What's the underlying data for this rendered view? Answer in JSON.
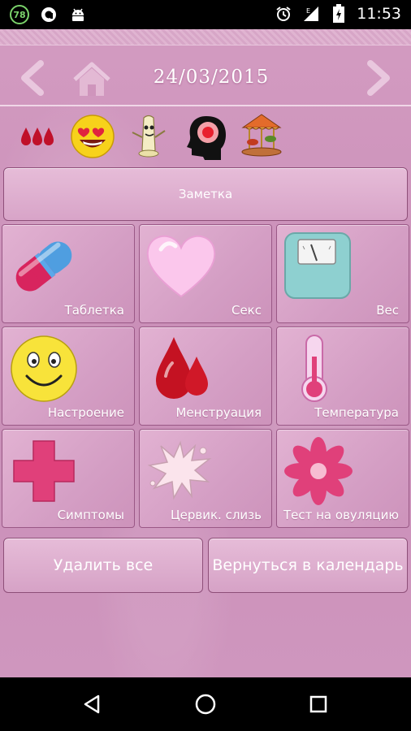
{
  "status_bar": {
    "notification_badge": "78",
    "time": "11:53",
    "icons": [
      "aptoide-icon",
      "android-icon",
      "alarm-icon",
      "signal-icon",
      "battery-icon"
    ]
  },
  "header": {
    "date": "24/03/2015",
    "icons": [
      "prev-arrow-icon",
      "home-icon",
      "next-arrow-icon"
    ]
  },
  "quick_icons": [
    "blood-drops-icon",
    "love-smiley-icon",
    "condom-icon",
    "head-brain-icon",
    "carousel-icon"
  ],
  "note_button": {
    "label": "Заметка"
  },
  "tiles": [
    {
      "label": "Таблетка",
      "icon": "pill-icon"
    },
    {
      "label": "Секс",
      "icon": "heart-icon"
    },
    {
      "label": "Вес",
      "icon": "scale-icon"
    },
    {
      "label": "Настроение",
      "icon": "smiley-icon"
    },
    {
      "label": "Менструация",
      "icon": "blood-drop-icon"
    },
    {
      "label": "Температура",
      "icon": "thermometer-icon"
    },
    {
      "label": "Симптомы",
      "icon": "cross-icon"
    },
    {
      "label": "Цервик. слизь",
      "icon": "splash-icon"
    },
    {
      "label": "Тест на овуляцию",
      "icon": "flower-icon"
    }
  ],
  "bottom_buttons": {
    "delete_all": "Удалить все",
    "back_to_calendar": "Вернуться в календарь"
  },
  "colors": {
    "background": "#d39bc1",
    "tile_border": "#9a5886",
    "accent_pink": "#e0407a"
  }
}
